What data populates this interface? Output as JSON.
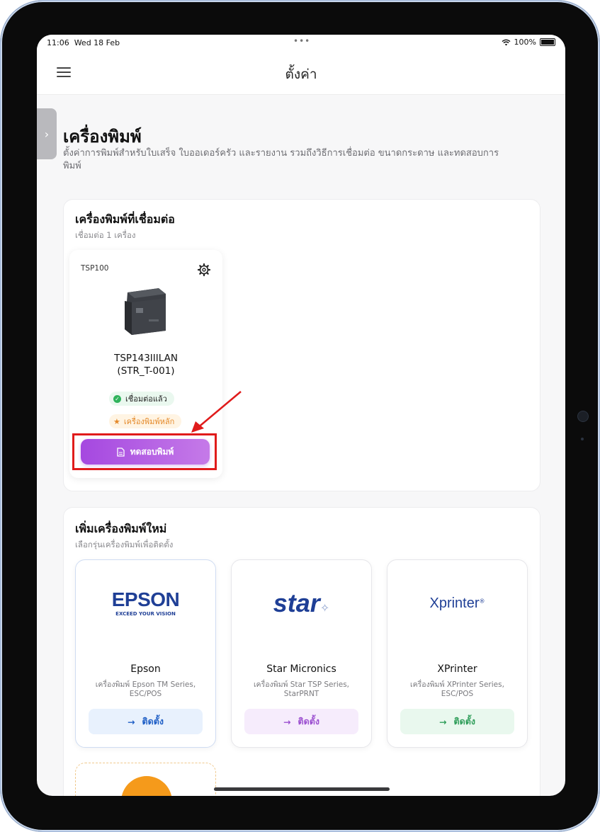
{
  "status": {
    "time": "11:06",
    "date": "Wed 18 Feb",
    "battery": "100%"
  },
  "nav": {
    "title": "ตั้งค่า"
  },
  "page": {
    "title": "เครื่องพิมพ์",
    "description": "ตั้งค่าการพิมพ์สำหรับใบเสร็จ ใบออเดอร์ครัว และรายงาน รวมถึงวิธีการเชื่อมต่อ ขนาดกระดาษ และทดสอบการพิมพ์"
  },
  "connected": {
    "title": "เครื่องพิมพ์ที่เชื่อมต่อ",
    "subtitle": "เชื่อมต่อ 1 เครื่อง",
    "printer": {
      "model": "TSP100",
      "name_line1": "TSP143IIILAN",
      "name_line2": "(STR_T-001)",
      "status_badge": "เชื่อมต่อแล้ว",
      "main_badge": "เครื่องพิมพ์หลัก",
      "test_button": "ทดสอบพิมพ์"
    }
  },
  "add_new": {
    "title": "เพิ่มเครื่องพิมพ์ใหม่",
    "subtitle": "เลือกรุ่นเครื่องพิมพ์เพื่อติดตั้ง",
    "brands": [
      {
        "logo": "EPSON",
        "tagline": "EXCEED YOUR VISION",
        "name": "Epson",
        "desc": "เครื่องพิมพ์ Epson TM Series, ESC/POS",
        "button": "ติดตั้ง",
        "color": "#1f4aa8"
      },
      {
        "logo": "star",
        "name": "Star Micronics",
        "desc": "เครื่องพิมพ์ Star TSP Series, StarPRNT",
        "button": "ติดตั้ง",
        "color": "#9b4fd0"
      },
      {
        "logo": "Xprinter",
        "name": "XPrinter",
        "desc": "เครื่องพิมพ์ XPrinter Series, ESC/POS",
        "button": "ติดตั้ง",
        "color": "#2f9e5a"
      }
    ]
  }
}
